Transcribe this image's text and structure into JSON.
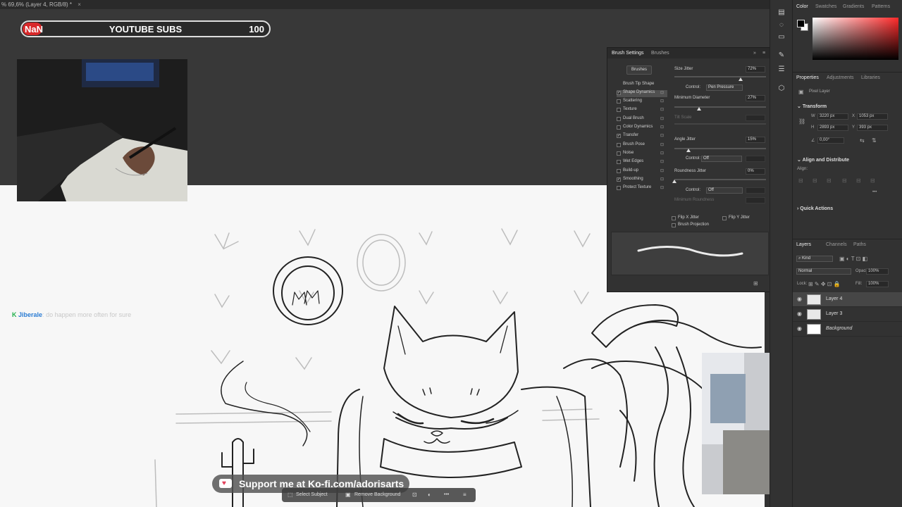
{
  "document": {
    "tab_title": "% 69,6% (Layer 4, RGB/8) *",
    "close": "×"
  },
  "overlay": {
    "subs_left": "NaN",
    "subs_title": "YOUTUBE SUBS",
    "subs_goal": "100",
    "kofi_text": "Support me at Ko-fi.com/adorisarts",
    "kofi_heart": "♥"
  },
  "chat": {
    "badge": "K",
    "user": "Jiberale",
    "separator": ":",
    "message": " do happen more often for sure"
  },
  "context_bar": {
    "select_subject": "Select Subject",
    "remove_background": "Remove Background",
    "more": "•••"
  },
  "brush_settings": {
    "tabs": [
      "Brush Settings",
      "Brushes"
    ],
    "brushes_button": "Brushes",
    "options": [
      {
        "label": "Brush Tip Shape",
        "checked": "",
        "lock": ""
      },
      {
        "label": "Shape Dynamics",
        "checked": "✓",
        "lock": "🔒"
      },
      {
        "label": "Scattering",
        "checked": "",
        "lock": "🔒"
      },
      {
        "label": "Texture",
        "checked": "",
        "lock": "🔒"
      },
      {
        "label": "Dual Brush",
        "checked": "",
        "lock": "🔒"
      },
      {
        "label": "Color Dynamics",
        "checked": "",
        "lock": "🔒"
      },
      {
        "label": "Transfer",
        "checked": "✓",
        "lock": "🔒"
      },
      {
        "label": "Brush Pose",
        "checked": "",
        "lock": "🔒"
      },
      {
        "label": "Noise",
        "checked": "",
        "lock": "🔒"
      },
      {
        "label": "Wet Edges",
        "checked": "",
        "lock": "🔒"
      },
      {
        "label": "Build-up",
        "checked": "",
        "lock": "🔒"
      },
      {
        "label": "Smoothing",
        "checked": "✓",
        "lock": "🔒"
      },
      {
        "label": "Protect Texture",
        "checked": "",
        "lock": "🔒"
      }
    ],
    "size_jitter": {
      "label": "Size Jitter",
      "value": "72%",
      "fraction": 0.72
    },
    "control_label": "Control:",
    "control_pen": "Pen Pressure",
    "minimum_diameter": {
      "label": "Minimum Diameter",
      "value": "27%",
      "fraction": 0.27
    },
    "tilt_scale": "Tilt Scale",
    "angle_jitter": {
      "label": "Angle Jitter",
      "value": "15%",
      "fraction": 0.15
    },
    "control_off": "Off",
    "roundness_jitter": {
      "label": "Roundness Jitter",
      "value": "0%",
      "fraction": 0.0
    },
    "minimum_roundness": "Minimum Roundness",
    "flip_x": "Flip X Jitter",
    "flip_y": "Flip Y Jitter",
    "brush_projection": "Brush Projection"
  },
  "color_panel": {
    "tabs": [
      "Color",
      "Swatches",
      "Gradients",
      "Patterns"
    ]
  },
  "properties": {
    "tabs": [
      "Properties",
      "Adjustments",
      "Libraries"
    ],
    "pixel_layer": "Pixel Layer",
    "transform_title": "Transform",
    "w_label": "W",
    "w_value": "3220 px",
    "h_label": "H",
    "h_value": "2893 px",
    "x_label": "X",
    "x_value": "1053 px",
    "y_label": "Y",
    "y_value": "393 px",
    "angle": "0,00°",
    "align_title": "Align and Distribute",
    "align_label": "Align:",
    "quick_actions": "Quick Actions"
  },
  "layers": {
    "tabs": [
      "Layers",
      "Channels",
      "Paths"
    ],
    "kind": "Kind",
    "blend": "Normal",
    "opacity_label": "Opacity:",
    "opacity": "100%",
    "lock_label": "Lock:",
    "fill_label": "Fill:",
    "fill": "100%",
    "items": [
      {
        "name": "Layer 4",
        "selected": true,
        "italic": false
      },
      {
        "name": "Layer 3",
        "selected": false,
        "italic": false
      },
      {
        "name": "Background",
        "selected": false,
        "italic": true
      }
    ]
  },
  "colors": {
    "accent_red": "#d8292a",
    "chat_user": "#2b7cd3",
    "chat_badge": "#22b14c"
  }
}
